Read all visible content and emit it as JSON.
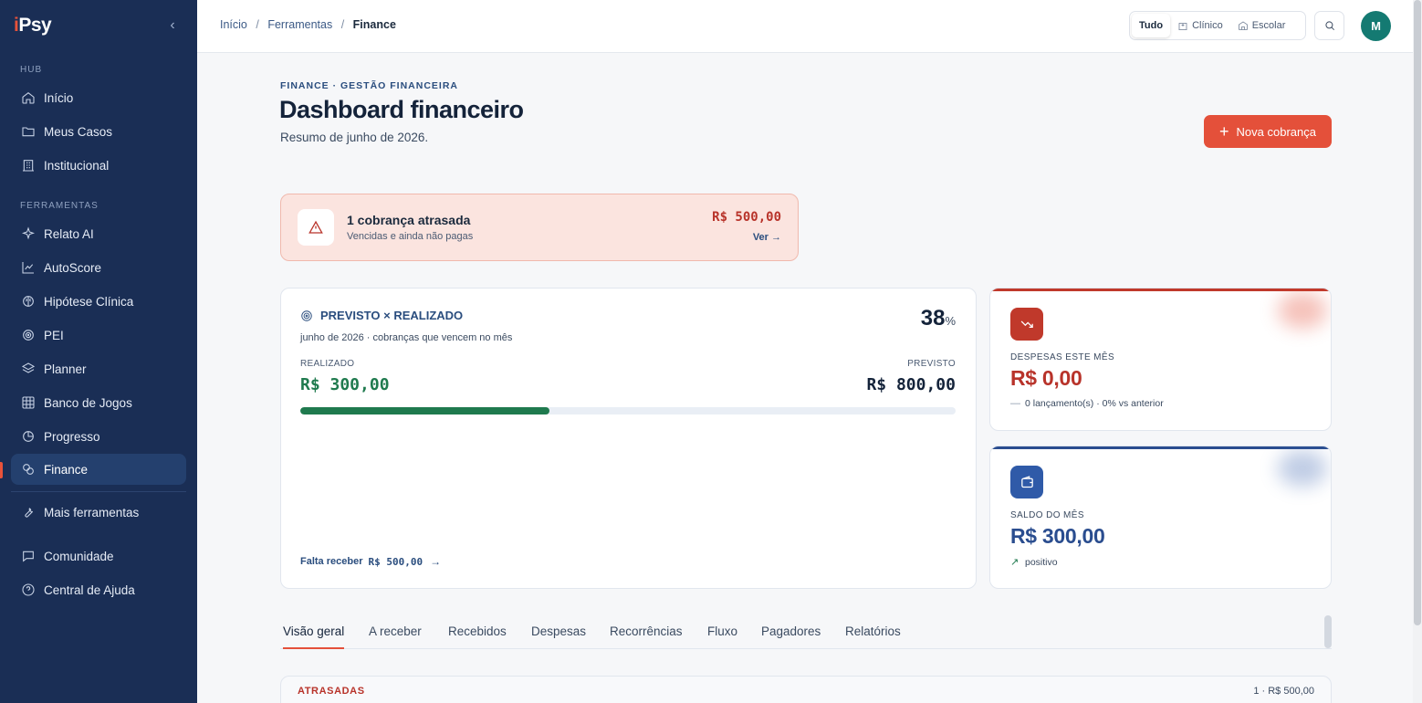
{
  "sidebar": {
    "brand_mark": "i",
    "brand_text": "Psy",
    "collapse_glyph": "‹",
    "section_hub": "HUB",
    "section_tools": "FERRAMENTAS",
    "items": [
      {
        "label": "Início",
        "icon": "home-icon"
      },
      {
        "label": "Meus Casos",
        "icon": "folder-icon"
      },
      {
        "label": "Institucional",
        "icon": "building-icon"
      },
      {
        "label": "Relato AI",
        "icon": "sparkles-icon"
      },
      {
        "label": "AutoScore",
        "icon": "chart-line-icon"
      },
      {
        "label": "Hipótese Clínica",
        "icon": "brain-icon"
      },
      {
        "label": "PEI",
        "icon": "target-icon"
      },
      {
        "label": "Planner",
        "icon": "layers-icon"
      },
      {
        "label": "Banco de Jogos",
        "icon": "grid-icon"
      },
      {
        "label": "Progresso",
        "icon": "pie-icon"
      },
      {
        "label": "Finance",
        "icon": "coins-icon",
        "active": true
      },
      {
        "label": "Mais ferramentas",
        "icon": "wrench-icon"
      },
      {
        "label": "Comunidade",
        "icon": "chat-icon"
      },
      {
        "label": "Central de Ajuda",
        "icon": "help-icon"
      }
    ]
  },
  "topbar": {
    "breadcrumb": [
      "Início",
      "Ferramentas",
      "Finance"
    ],
    "breadcrumb_sep": "/",
    "filter": {
      "options": [
        "Tudo",
        "Clínico",
        "Escolar"
      ],
      "selected": "Tudo"
    },
    "avatar_initial": "M"
  },
  "header": {
    "eyebrow": "FINANCE · GESTÃO FINANCEIRA",
    "title": "Dashboard financeiro",
    "subtitle": "Resumo de junho de 2026.",
    "cta_plus": "+",
    "cta_label": "Nova cobrança"
  },
  "alert": {
    "title": "1 cobrança atrasada",
    "description": "Vencidas e ainda não pagas",
    "amount": "R$ 500,00",
    "link": "Ver →"
  },
  "forecast": {
    "title": "PREVISTO × REALIZADO",
    "percent": "38",
    "percent_sign": "%",
    "subtitle": "junho de 2026 · cobranças que vencem no mês",
    "realized_label": "REALIZADO",
    "realized_value": "R$ 300,00",
    "expected_label": "PREVISTO",
    "expected_value": "R$ 800,00",
    "progress_fraction": 0.38,
    "footer_label": "Falta receber",
    "footer_value": "R$ 500,00",
    "footer_arrow": "→"
  },
  "kpis": {
    "expenses": {
      "label": "DESPESAS ESTE MÊS",
      "value": "R$ 0,00",
      "note_marker": "—",
      "note": "0 lançamento(s) · 0% vs anterior",
      "color": "#b8332a",
      "icon": "trending-down-icon"
    },
    "balance": {
      "label": "SALDO DO MÊS",
      "value": "R$ 300,00",
      "note_marker": "↗",
      "note": "positivo",
      "color": "#2a4d8f",
      "icon": "wallet-icon"
    }
  },
  "tabs": [
    {
      "label": "Visão geral",
      "active": true
    },
    {
      "label": "A receber"
    },
    {
      "label": "Recebidos"
    },
    {
      "label": "Despesas"
    },
    {
      "label": "Recorrências"
    },
    {
      "label": "Fluxo"
    },
    {
      "label": "Pagadores"
    },
    {
      "label": "Relatórios"
    }
  ],
  "overdue_section": {
    "title": "ATRASADAS",
    "summary": "1 · R$ 500,00"
  },
  "colors": {
    "accent": "#e4503a",
    "sidebar_bg": "#1a2e55",
    "success": "#1f7a4e",
    "danger": "#b8332a",
    "navy": "#2a4d7e"
  }
}
